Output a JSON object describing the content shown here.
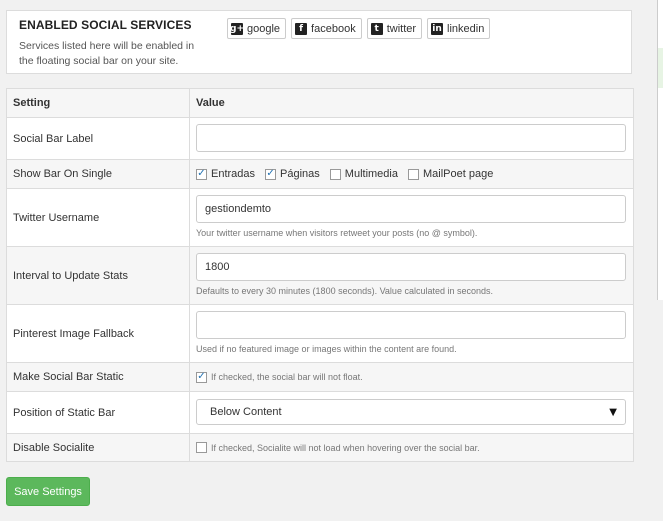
{
  "services": {
    "title": "ENABLED SOCIAL SERVICES",
    "description": "Services listed here will be enabled in the floating social bar on your site.",
    "buttons": [
      {
        "label": "google",
        "icon": "google-icon",
        "glyph": "g+"
      },
      {
        "label": "facebook",
        "icon": "facebook-icon",
        "glyph": "f"
      },
      {
        "label": "twitter",
        "icon": "twitter-icon",
        "glyph": "t"
      },
      {
        "label": "linkedin",
        "icon": "linkedin-icon",
        "glyph": "in"
      }
    ]
  },
  "table": {
    "header": {
      "setting": "Setting",
      "value": "Value"
    },
    "social_bar_label": {
      "label": "Social Bar Label",
      "value": ""
    },
    "show_bar_on_single": {
      "label": "Show Bar On Single",
      "options": [
        {
          "label": "Entradas",
          "checked": true
        },
        {
          "label": "Páginas",
          "checked": true
        },
        {
          "label": "Multimedia",
          "checked": false
        },
        {
          "label": "MailPoet page",
          "checked": false
        }
      ]
    },
    "twitter_username": {
      "label": "Twitter Username",
      "value": "gestiondemto",
      "help": "Your twitter username when visitors retweet your posts (no @ symbol)."
    },
    "interval": {
      "label": "Interval to Update Stats",
      "value": "1800",
      "help": "Defaults to every 30 minutes (1800 seconds). Value calculated in seconds."
    },
    "pinterest": {
      "label": "Pinterest Image Fallback",
      "value": "",
      "help": "Used if no featured image or images within the content are found."
    },
    "static": {
      "label": "Make Social Bar Static",
      "checked": true,
      "help": "If checked, the social bar will not float."
    },
    "position": {
      "label": "Position of Static Bar",
      "selected": "Below Content"
    },
    "disable": {
      "label": "Disable Socialite",
      "checked": false,
      "help": "If checked, Socialite will not load when hovering over the social bar."
    }
  },
  "save_label": "Save Settings",
  "colors": {
    "save_button": "#5cb85c",
    "checkbox_tick": "#2271b1"
  }
}
